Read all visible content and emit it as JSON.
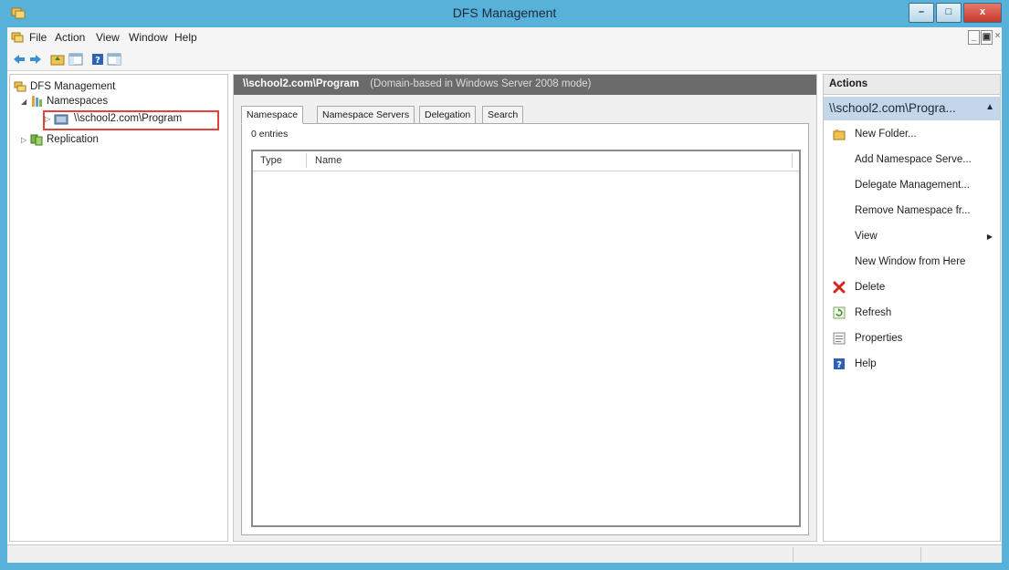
{
  "window": {
    "title": "DFS Management",
    "controls": {
      "minimize": "–",
      "maximize": "□",
      "close": "x"
    }
  },
  "menu": {
    "items": [
      "File",
      "Action",
      "View",
      "Window",
      "Help"
    ],
    "mdi_controls": {
      "minimize": "_",
      "restore": "▣",
      "close": "×"
    }
  },
  "toolbar": {
    "icons": [
      "back-arrow-icon",
      "forward-arrow-icon",
      "up-folder-icon",
      "show-hide-console-tree-icon",
      "help-icon",
      "action-pane-icon"
    ]
  },
  "tree": {
    "root": "DFS Management",
    "namespaces": "Namespaces",
    "namespace_item": "\\\\school2.com\\Program",
    "replication": "Replication"
  },
  "center": {
    "header_path": "\\\\school2.com\\Program",
    "header_mode": "(Domain-based in Windows Server 2008 mode)",
    "tabs": [
      "Namespace",
      "Namespace Servers",
      "Delegation",
      "Search"
    ],
    "active_tab": "Namespace",
    "entries_label": "0 entries",
    "columns": [
      "Type",
      "Name"
    ]
  },
  "actions": {
    "header": "Actions",
    "context": "\\\\school2.com\\Progra...",
    "items": [
      {
        "label": "New Folder...",
        "icon": "new-folder-icon"
      },
      {
        "label": "Add Namespace Serve...",
        "icon": ""
      },
      {
        "label": "Delegate Management...",
        "icon": ""
      },
      {
        "label": "Remove Namespace fr...",
        "icon": ""
      },
      {
        "label": "View",
        "icon": "",
        "submenu": true
      },
      {
        "label": "New Window from Here",
        "icon": ""
      },
      {
        "label": "Delete",
        "icon": "delete-icon"
      },
      {
        "label": "Refresh",
        "icon": "refresh-icon"
      },
      {
        "label": "Properties",
        "icon": "properties-icon"
      },
      {
        "label": "Help",
        "icon": "help-icon"
      }
    ]
  },
  "colors": {
    "titlebar": "#58b1d9",
    "selection_outline": "#e2443a",
    "center_header": "#6b6b6b",
    "actions_context": "#c4d7ea",
    "delete_red": "#d9261c"
  }
}
